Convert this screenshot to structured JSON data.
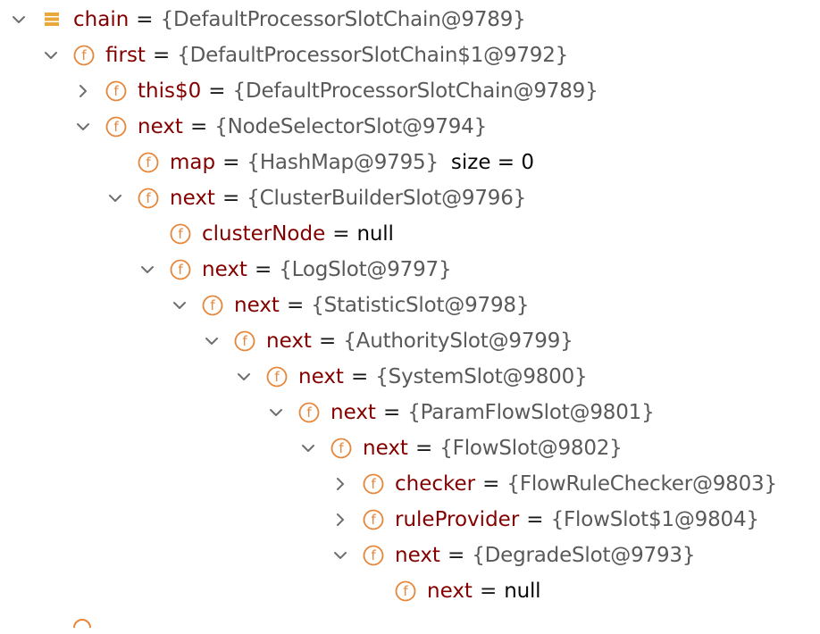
{
  "rows": [
    {
      "indent": 0,
      "toggle": "expanded",
      "icon": "list",
      "name": "chain",
      "value": "{DefaultProcessorSlotChain@9789}",
      "extra": ""
    },
    {
      "indent": 1,
      "toggle": "expanded",
      "icon": "field",
      "name": "first",
      "value": "{DefaultProcessorSlotChain$1@9792}",
      "extra": ""
    },
    {
      "indent": 2,
      "toggle": "collapsed",
      "icon": "field",
      "name": "this$0",
      "value": "{DefaultProcessorSlotChain@9789}",
      "extra": ""
    },
    {
      "indent": 2,
      "toggle": "expanded",
      "icon": "field",
      "name": "next",
      "value": "{NodeSelectorSlot@9794}",
      "extra": ""
    },
    {
      "indent": 3,
      "toggle": "none",
      "icon": "field",
      "name": "map",
      "value": "{HashMap@9795}",
      "extra": "size = 0"
    },
    {
      "indent": 3,
      "toggle": "expanded",
      "icon": "field",
      "name": "next",
      "value": "{ClusterBuilderSlot@9796}",
      "extra": ""
    },
    {
      "indent": 4,
      "toggle": "none",
      "icon": "field",
      "name": "clusterNode",
      "value": "null",
      "extra": "",
      "plain": true
    },
    {
      "indent": 4,
      "toggle": "expanded",
      "icon": "field",
      "name": "next",
      "value": "{LogSlot@9797}",
      "extra": ""
    },
    {
      "indent": 5,
      "toggle": "expanded",
      "icon": "field",
      "name": "next",
      "value": "{StatisticSlot@9798}",
      "extra": ""
    },
    {
      "indent": 6,
      "toggle": "expanded",
      "icon": "field",
      "name": "next",
      "value": "{AuthoritySlot@9799}",
      "extra": ""
    },
    {
      "indent": 7,
      "toggle": "expanded",
      "icon": "field",
      "name": "next",
      "value": "{SystemSlot@9800}",
      "extra": ""
    },
    {
      "indent": 8,
      "toggle": "expanded",
      "icon": "field",
      "name": "next",
      "value": "{ParamFlowSlot@9801}",
      "extra": ""
    },
    {
      "indent": 9,
      "toggle": "expanded",
      "icon": "field",
      "name": "next",
      "value": "{FlowSlot@9802}",
      "extra": ""
    },
    {
      "indent": 10,
      "toggle": "collapsed",
      "icon": "field",
      "name": "checker",
      "value": "{FlowRuleChecker@9803}",
      "extra": ""
    },
    {
      "indent": 10,
      "toggle": "collapsed",
      "icon": "field",
      "name": "ruleProvider",
      "value": "{FlowSlot$1@9804}",
      "extra": ""
    },
    {
      "indent": 10,
      "toggle": "expanded",
      "icon": "field",
      "name": "next",
      "value": "{DegradeSlot@9793}",
      "extra": ""
    },
    {
      "indent": 11,
      "toggle": "none",
      "icon": "field",
      "name": "next",
      "value": "null",
      "extra": "",
      "plain": true
    }
  ],
  "equals": "=",
  "colors": {
    "field_name": "#830000",
    "value": "#595959",
    "plain_value": "#080808",
    "icon_orange": "#E8873A",
    "chain_icon": "#E8A93A",
    "chevron": "#6E6E6E"
  }
}
